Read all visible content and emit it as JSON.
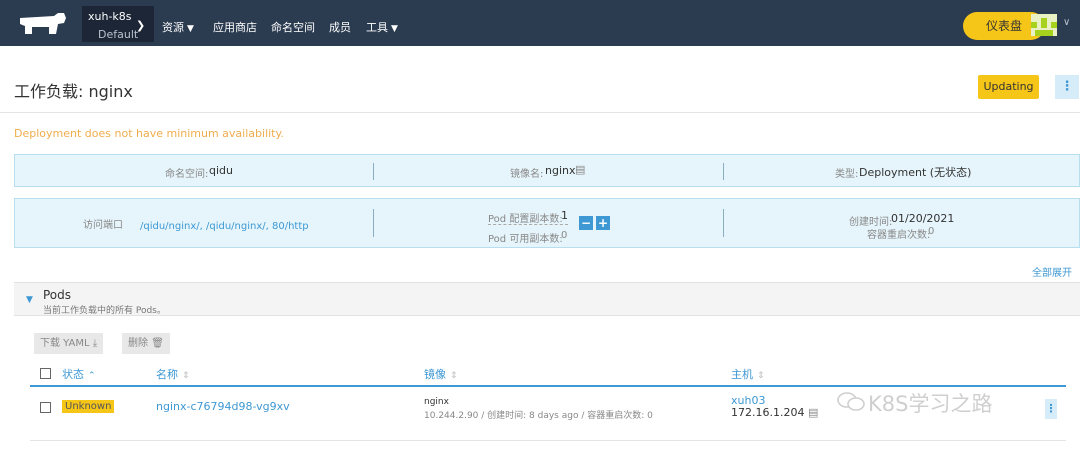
{
  "nav": {
    "cluster_name": "xuh-k8s",
    "cluster_project": "Default",
    "items": [
      {
        "label": "资源",
        "has_caret": true
      },
      {
        "label": "应用商店",
        "has_caret": false
      },
      {
        "label": "命名空间",
        "has_caret": false
      },
      {
        "label": "成员",
        "has_caret": false
      },
      {
        "label": "工具",
        "has_caret": true
      }
    ],
    "dashboard_label": "仪表盘",
    "logo_icon": "rancher-cow-icon",
    "brand_color": "#2b3b50",
    "accent_color": "#f5c518"
  },
  "header": {
    "title": "工作负载: nginx",
    "state_button": "Updating",
    "more_icon": "kebab-icon"
  },
  "warning": "Deployment does not have minimum availability.",
  "info_row1": {
    "namespace_label": "命名空间:",
    "namespace_value": "qidu",
    "image_label": "镜像名:",
    "image_value": "nginx",
    "type_label": "类型:",
    "type_value": "Deployment (无状态)"
  },
  "info_row2": {
    "endpoints_label": "访问端口",
    "endpoints_value": "/qidu/nginx/, /qidu/nginx/, 80/http",
    "scale_label": "Pod 配置副本数:",
    "scale_value": "1",
    "available_label": "Pod 可用副本数:",
    "available_value": "0",
    "created_label": "创建时间:",
    "created_value": "01/20/2021",
    "restarts_label": "容器重启次数:",
    "restarts_value": "0"
  },
  "expand_all": "全部展开",
  "pods": {
    "title": "Pods",
    "subtitle": "当前工作负载中的所有 Pods。",
    "download_label": "下载 YAML",
    "delete_label": "删除",
    "columns": {
      "state": "状态",
      "name": "名称",
      "image": "镜像",
      "node": "主机"
    },
    "rows": [
      {
        "state": "Unknown",
        "name": "nginx-c76794d98-vg9xv",
        "image": "nginx",
        "image_detail": "10.244.2.90 / 创建时间: 8 days ago / 容器重启次数: 0",
        "node": "xuh03",
        "node_ip": "172.16.1.204"
      }
    ]
  },
  "watermark": "K8S学习之路"
}
